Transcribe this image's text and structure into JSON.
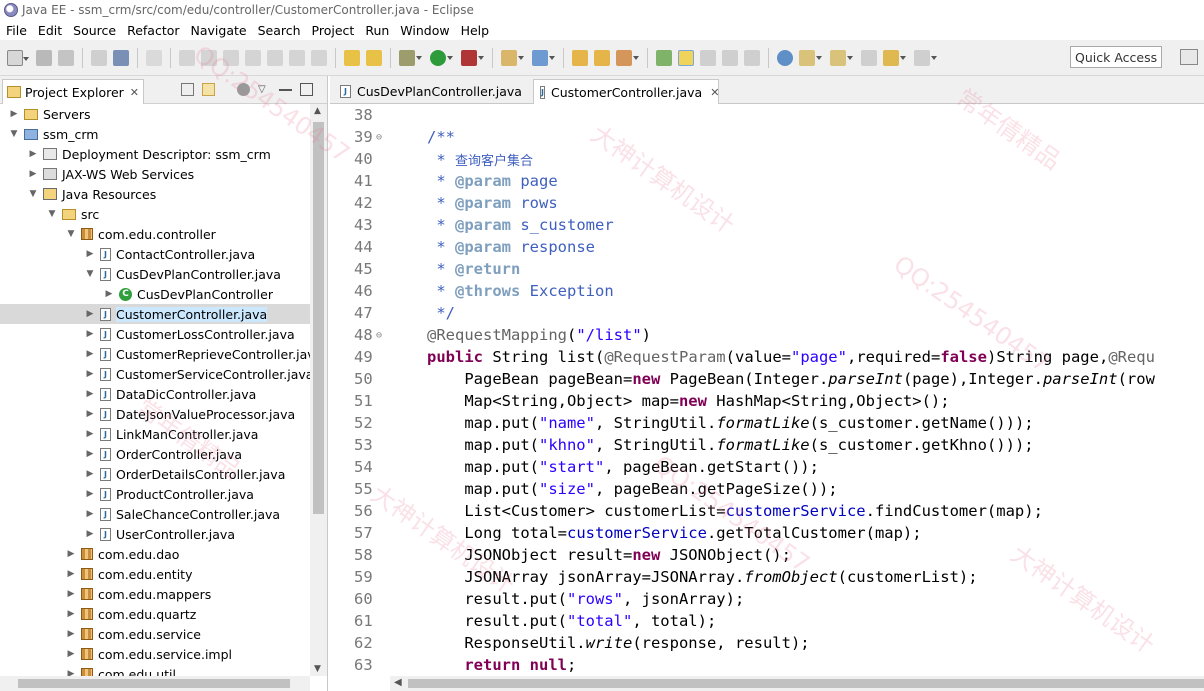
{
  "window": {
    "title": "Java EE - ssm_crm/src/com/edu/controller/CustomerController.java - Eclipse"
  },
  "menu": [
    "File",
    "Edit",
    "Source",
    "Refactor",
    "Navigate",
    "Search",
    "Project",
    "Run",
    "Window",
    "Help"
  ],
  "toolbar": {
    "quick_access": "Quick Access"
  },
  "explorer": {
    "title": "Project Explorer",
    "tree": [
      {
        "label": "Servers",
        "icon": "folder-icon",
        "depth": 0,
        "twisty": "collapsed"
      },
      {
        "label": "ssm_crm",
        "icon": "project-icon",
        "depth": 0,
        "twisty": "expanded"
      },
      {
        "label": "Deployment Descriptor: ssm_crm",
        "icon": "deployment-descriptor-icon",
        "depth": 1,
        "twisty": "collapsed"
      },
      {
        "label": "JAX-WS Web Services",
        "icon": "web-services-icon",
        "depth": 1,
        "twisty": "collapsed"
      },
      {
        "label": "Java Resources",
        "icon": "java-resources-icon",
        "depth": 1,
        "twisty": "expanded"
      },
      {
        "label": "src",
        "icon": "source-folder-icon",
        "depth": 2,
        "twisty": "expanded"
      },
      {
        "label": "com.edu.controller",
        "icon": "package-icon",
        "depth": 3,
        "twisty": "expanded"
      },
      {
        "label": "ContactController.java",
        "icon": "java-file-icon",
        "depth": 4,
        "twisty": "collapsed"
      },
      {
        "label": "CusDevPlanController.java",
        "icon": "java-file-icon",
        "depth": 4,
        "twisty": "expanded"
      },
      {
        "label": "CusDevPlanController",
        "icon": "class-icon",
        "depth": 5,
        "twisty": "collapsed"
      },
      {
        "label": "CustomerController.java",
        "icon": "java-file-icon",
        "depth": 4,
        "twisty": "collapsed",
        "selected": true
      },
      {
        "label": "CustomerLossController.java",
        "icon": "java-file-icon",
        "depth": 4,
        "twisty": "collapsed"
      },
      {
        "label": "CustomerReprieveController.java",
        "icon": "java-file-icon",
        "depth": 4,
        "twisty": "collapsed"
      },
      {
        "label": "CustomerServiceController.java",
        "icon": "java-file-icon",
        "depth": 4,
        "twisty": "collapsed"
      },
      {
        "label": "DataDicController.java",
        "icon": "java-file-icon",
        "depth": 4,
        "twisty": "collapsed"
      },
      {
        "label": "DateJsonValueProcessor.java",
        "icon": "java-file-icon",
        "depth": 4,
        "twisty": "collapsed"
      },
      {
        "label": "LinkManController.java",
        "icon": "java-file-icon",
        "depth": 4,
        "twisty": "collapsed"
      },
      {
        "label": "OrderController.java",
        "icon": "java-file-icon",
        "depth": 4,
        "twisty": "collapsed"
      },
      {
        "label": "OrderDetailsController.java",
        "icon": "java-file-icon",
        "depth": 4,
        "twisty": "collapsed"
      },
      {
        "label": "ProductController.java",
        "icon": "java-file-icon",
        "depth": 4,
        "twisty": "collapsed"
      },
      {
        "label": "SaleChanceController.java",
        "icon": "java-file-icon",
        "depth": 4,
        "twisty": "collapsed"
      },
      {
        "label": "UserController.java",
        "icon": "java-file-icon",
        "depth": 4,
        "twisty": "collapsed"
      },
      {
        "label": "com.edu.dao",
        "icon": "package-icon",
        "depth": 3,
        "twisty": "collapsed"
      },
      {
        "label": "com.edu.entity",
        "icon": "package-icon",
        "depth": 3,
        "twisty": "collapsed"
      },
      {
        "label": "com.edu.mappers",
        "icon": "package-icon",
        "depth": 3,
        "twisty": "collapsed"
      },
      {
        "label": "com.edu.quartz",
        "icon": "package-icon",
        "depth": 3,
        "twisty": "collapsed"
      },
      {
        "label": "com.edu.service",
        "icon": "package-icon",
        "depth": 3,
        "twisty": "collapsed"
      },
      {
        "label": "com.edu.service.impl",
        "icon": "package-icon",
        "depth": 3,
        "twisty": "collapsed"
      },
      {
        "label": "com.edu.util",
        "icon": "package-icon",
        "depth": 3,
        "twisty": "collapsed"
      }
    ]
  },
  "editor": {
    "tabs": [
      {
        "label": "CusDevPlanController.java",
        "active": false
      },
      {
        "label": "CustomerController.java",
        "active": true
      }
    ],
    "lines": [
      {
        "n": "38",
        "code": ""
      },
      {
        "n": "39",
        "code": "/**",
        "fold": true
      },
      {
        "n": "40",
        "code": " * 查询客户集合"
      },
      {
        "n": "41",
        "code": " * @param page"
      },
      {
        "n": "42",
        "code": " * @param rows"
      },
      {
        "n": "43",
        "code": " * @param s_customer"
      },
      {
        "n": "44",
        "code": " * @param response"
      },
      {
        "n": "45",
        "code": " * @return"
      },
      {
        "n": "46",
        "code": " * @throws Exception"
      },
      {
        "n": "47",
        "code": " */"
      },
      {
        "n": "48",
        "code": "@RequestMapping(\"/list\")",
        "fold": true
      },
      {
        "n": "49",
        "code": "public String list(@RequestParam(value=\"page\",required=false)String page,@Requ"
      },
      {
        "n": "50",
        "code": "    PageBean pageBean=new PageBean(Integer.parseInt(page),Integer.parseInt(row"
      },
      {
        "n": "51",
        "code": "    Map<String,Object> map=new HashMap<String,Object>();"
      },
      {
        "n": "52",
        "code": "    map.put(\"name\", StringUtil.formatLike(s_customer.getName()));"
      },
      {
        "n": "53",
        "code": "    map.put(\"khno\", StringUtil.formatLike(s_customer.getKhno()));"
      },
      {
        "n": "54",
        "code": "    map.put(\"start\", pageBean.getStart());"
      },
      {
        "n": "55",
        "code": "    map.put(\"size\", pageBean.getPageSize());"
      },
      {
        "n": "56",
        "code": "    List<Customer> customerList=customerService.findCustomer(map);"
      },
      {
        "n": "57",
        "code": "    Long total=customerService.getTotalCustomer(map);"
      },
      {
        "n": "58",
        "code": "    JSONObject result=new JSONObject();"
      },
      {
        "n": "59",
        "code": "    JSONArray jsonArray=JSONArray.fromObject(customerList);"
      },
      {
        "n": "60",
        "code": "    result.put(\"rows\", jsonArray);"
      },
      {
        "n": "61",
        "code": "    result.put(\"total\", total);"
      },
      {
        "n": "62",
        "code": "    ResponseUtil.write(response, result);"
      },
      {
        "n": "63",
        "code": "    return null;"
      }
    ]
  },
  "watermarks": [
    "QQ:254540457",
    "大神计算机设计",
    "常年倩精品"
  ],
  "colors": {
    "keyword": "#7f0055",
    "string": "#2a00ff",
    "comment": "#3f5fbf",
    "field": "#0000c0",
    "selection": "#cce8ff"
  }
}
